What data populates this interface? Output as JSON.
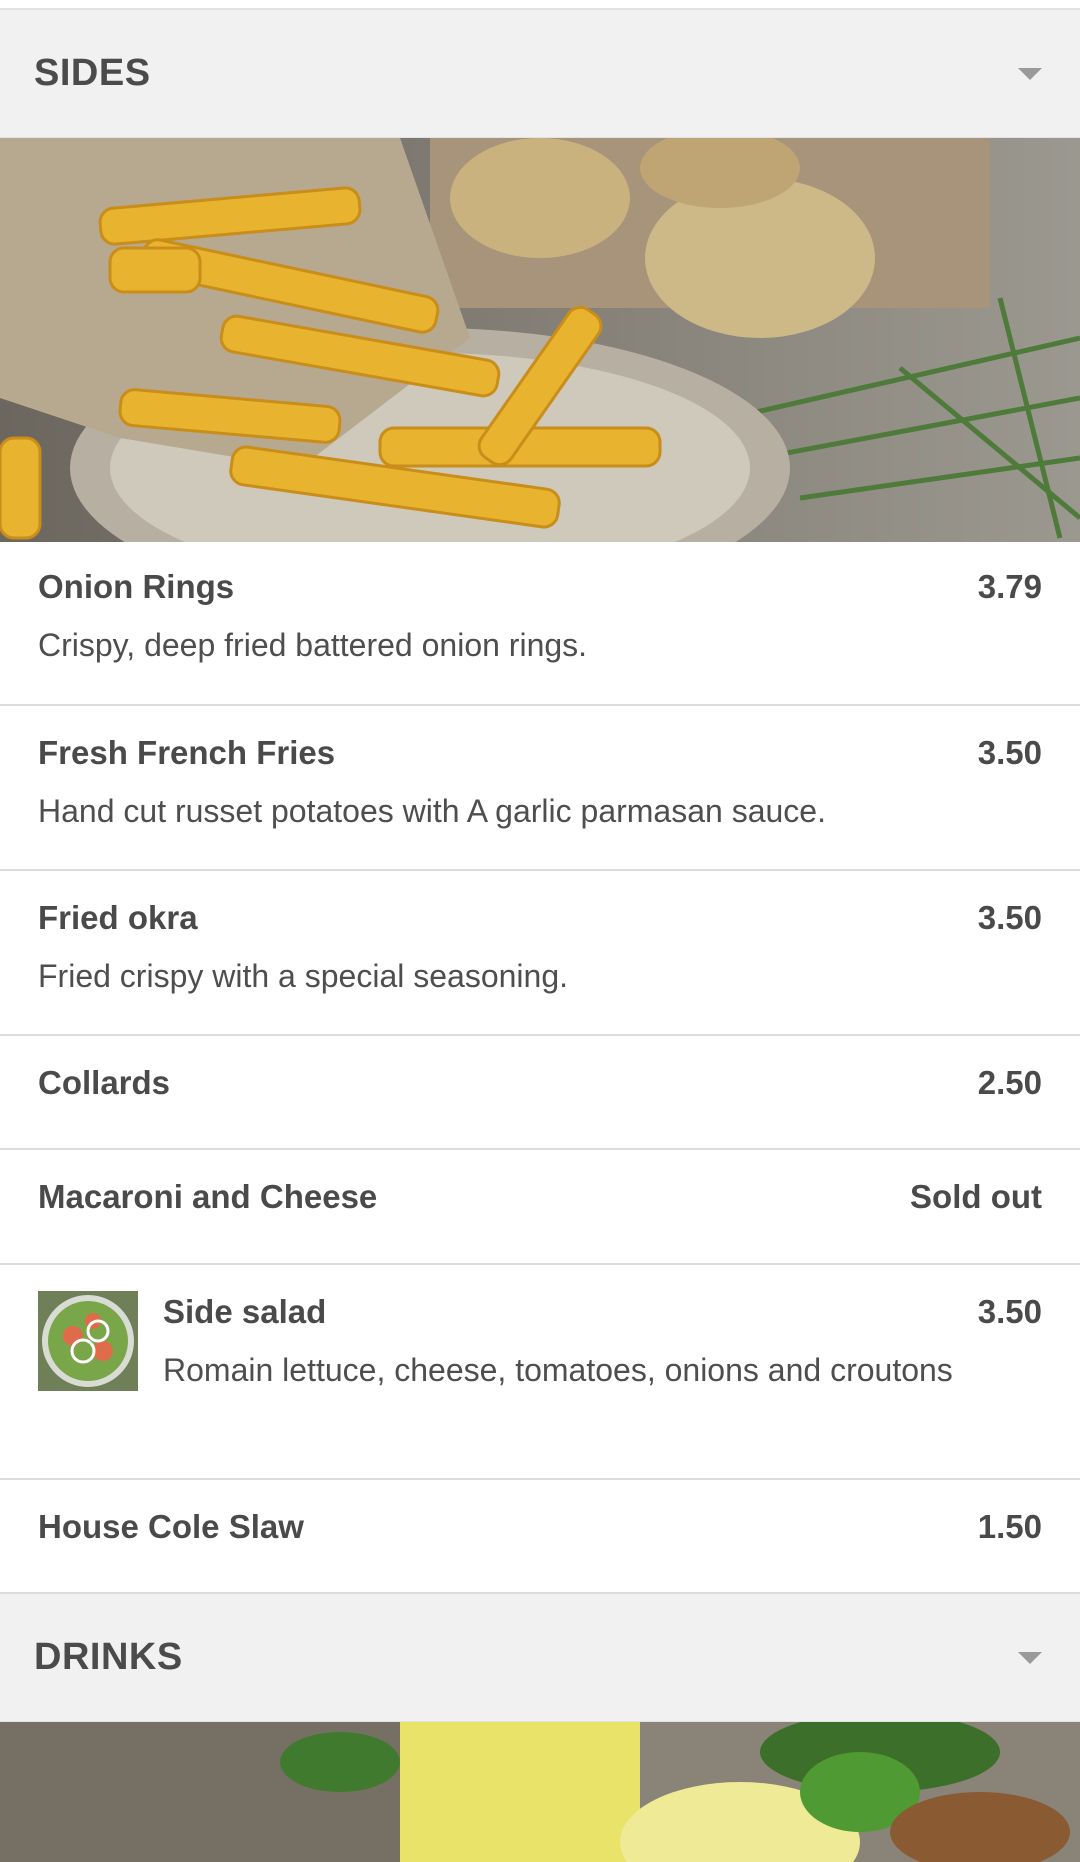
{
  "sections": [
    {
      "title": "SIDES",
      "items": [
        {
          "name": "Onion Rings",
          "price": "3.79",
          "description": "Crispy, deep fried battered onion rings."
        },
        {
          "name": "Fresh French Fries",
          "price": "3.50",
          "description": "Hand cut russet potatoes with A garlic parmasan sauce."
        },
        {
          "name": "Fried okra",
          "price": "3.50",
          "description": "Fried crispy with a special seasoning."
        },
        {
          "name": "Collards",
          "price": "2.50"
        },
        {
          "name": "Macaroni and Cheese",
          "price": "Sold out"
        },
        {
          "name": "Side salad",
          "price": "3.50",
          "description": "Romain lettuce, cheese, tomatoes, onions and croutons",
          "has_thumbnail": true
        },
        {
          "name": "House Cole Slaw",
          "price": "1.50"
        }
      ]
    },
    {
      "title": "DRINKS"
    }
  ],
  "icons": {
    "section_toggle": "chevron-down-icon",
    "thumbnail": "salad-thumbnail"
  },
  "colors": {
    "header_bg": "#f1f1f1",
    "text": "#4a4a4a",
    "divider": "#dcdcdc",
    "caret": "#9a9a9a"
  }
}
